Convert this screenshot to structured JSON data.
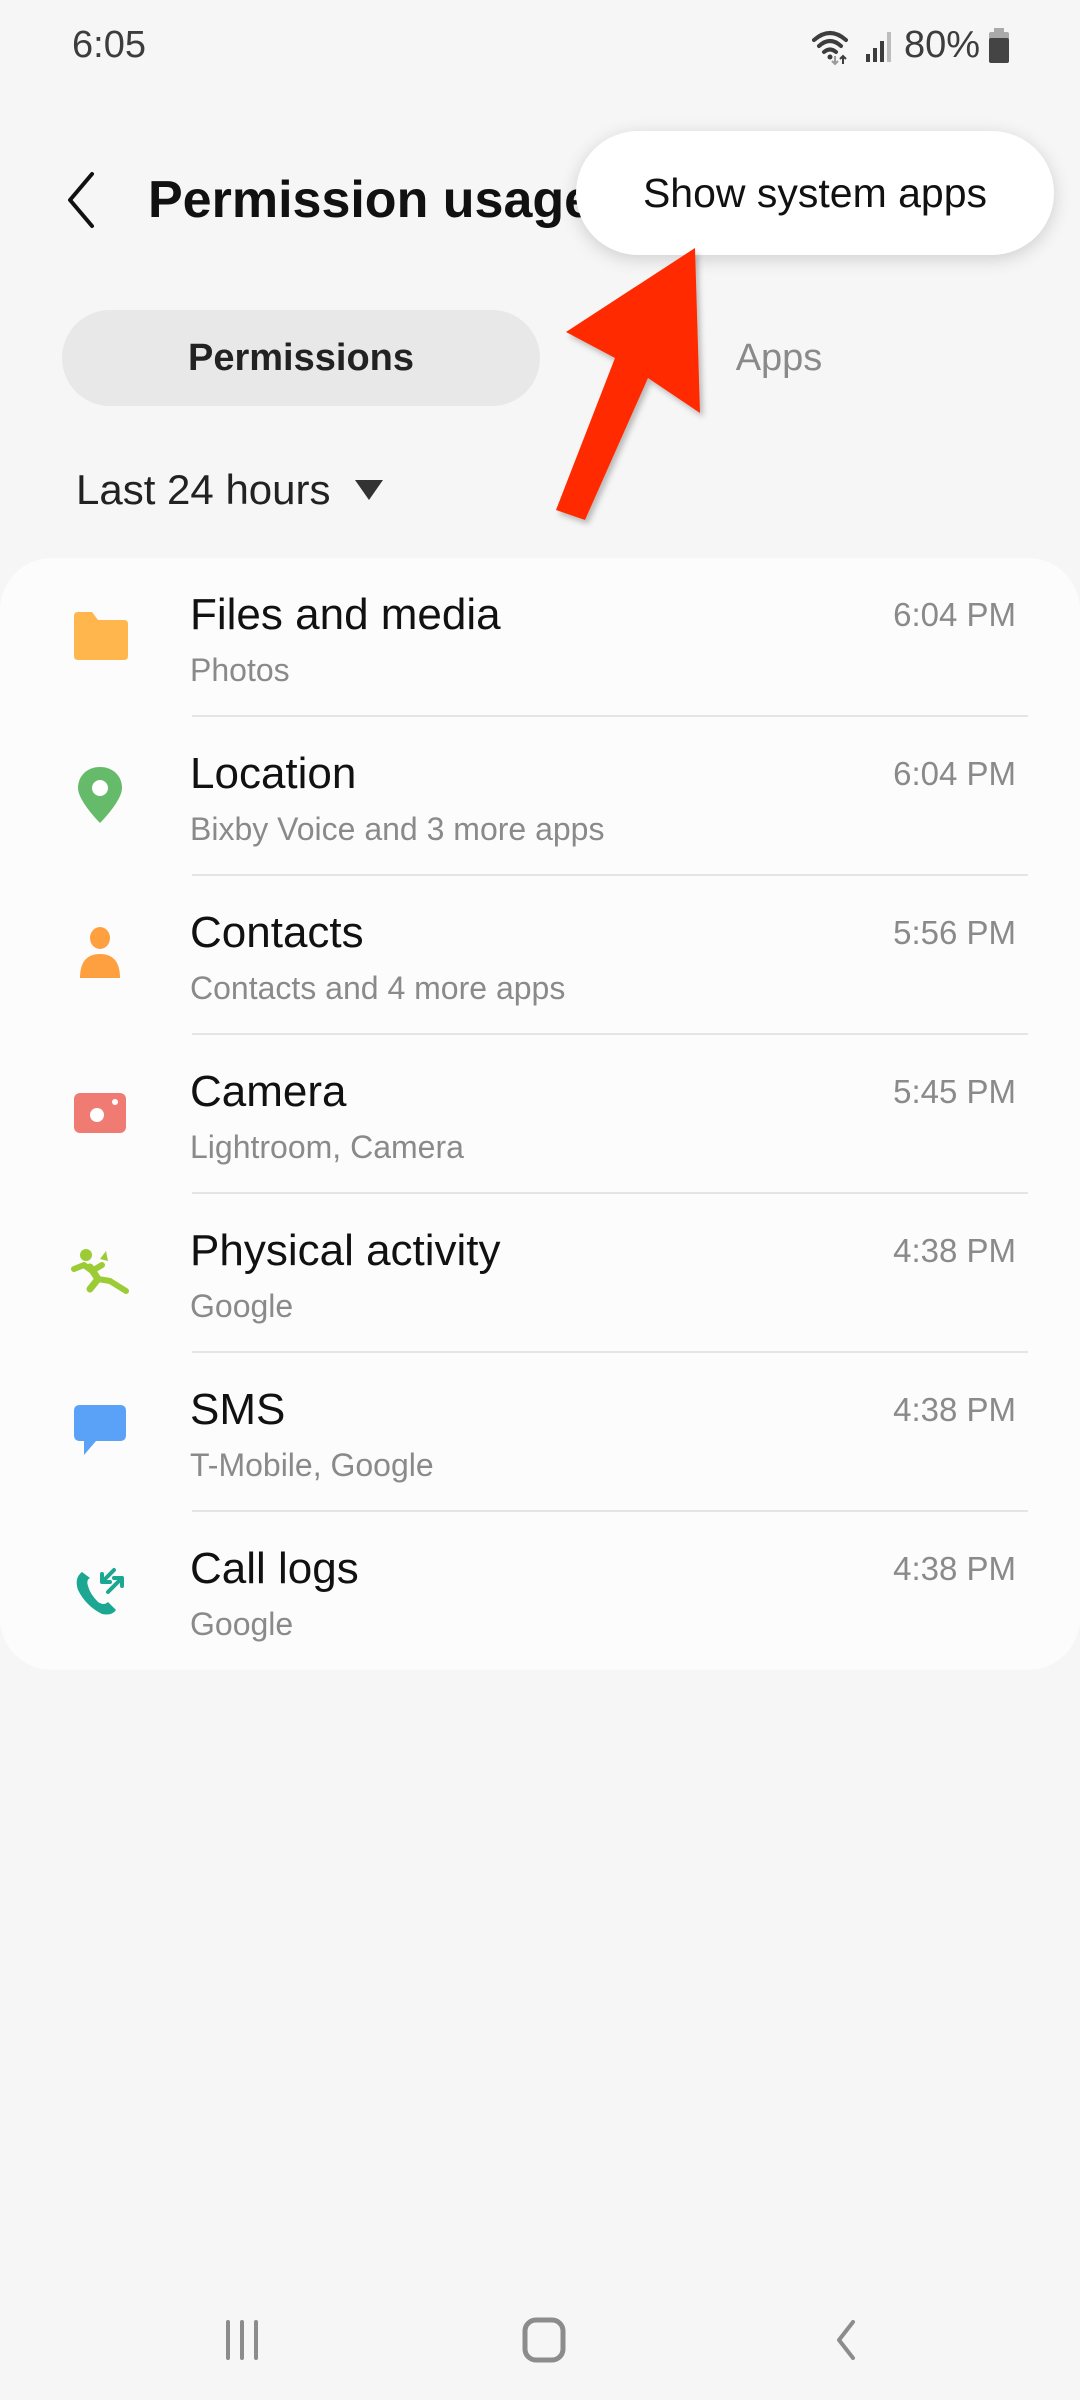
{
  "status_bar": {
    "time": "6:05",
    "battery_percent": "80%",
    "icons": [
      "wifi-icon",
      "signal-icon",
      "battery-icon"
    ]
  },
  "header": {
    "title": "Permission usage",
    "back_icon": "chevron-left-icon"
  },
  "popup_menu": {
    "items": [
      {
        "label": "Show system apps"
      }
    ]
  },
  "tabs": [
    {
      "label": "Permissions",
      "selected": true
    },
    {
      "label": "Apps",
      "selected": false
    }
  ],
  "filter": {
    "selected": "Last 24 hours"
  },
  "permissions": [
    {
      "title": "Files and media",
      "subtitle": "Photos",
      "time": "6:04 PM",
      "icon": "folder-icon",
      "color": "#ffb74d"
    },
    {
      "title": "Location",
      "subtitle": "Bixby Voice and 3 more apps",
      "time": "6:04 PM",
      "icon": "location-pin-icon",
      "color": "#66bb6a"
    },
    {
      "title": "Contacts",
      "subtitle": "Contacts and 4 more apps",
      "time": "5:56 PM",
      "icon": "person-icon",
      "color": "#ffa040"
    },
    {
      "title": "Camera",
      "subtitle": "Lightroom, Camera",
      "time": "5:45 PM",
      "icon": "camera-icon",
      "color": "#ef7b72"
    },
    {
      "title": "Physical activity",
      "subtitle": "Google",
      "time": "4:38 PM",
      "icon": "running-person-icon",
      "color": "#9ccc35"
    },
    {
      "title": "SMS",
      "subtitle": "T-Mobile, Google",
      "time": "4:38 PM",
      "icon": "message-bubble-icon",
      "color": "#5aa2f7"
    },
    {
      "title": "Call logs",
      "subtitle": "Google",
      "time": "4:38 PM",
      "icon": "call-log-icon",
      "color": "#1ba792"
    }
  ],
  "annotation": {
    "arrow_color": "#ff2a00"
  },
  "nav_bar": {
    "buttons": [
      "recents-icon",
      "home-icon",
      "back-icon"
    ]
  }
}
